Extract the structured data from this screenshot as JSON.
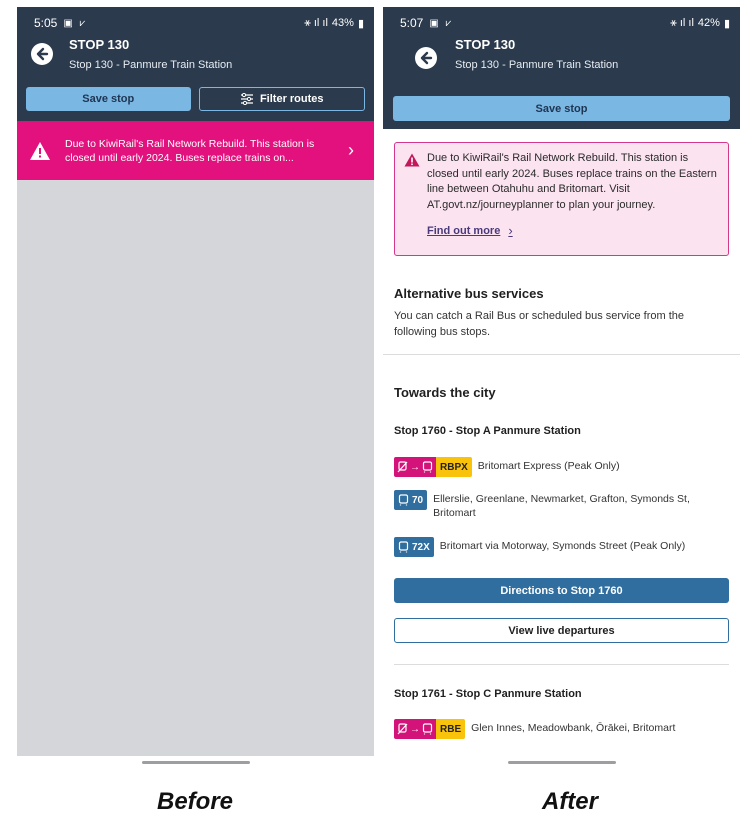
{
  "before": {
    "status": {
      "time": "5:05",
      "icons": "▣ ⩗",
      "right": "43%"
    },
    "stop_title": "STOP 130",
    "stop_subtitle": "Stop 130 - Panmure Train Station",
    "save_label": "Save stop",
    "filter_label": "Filter routes",
    "alert_text": "Due to KiwiRail's Rail Network Rebuild. This station is closed until early 2024. Buses replace trains on..."
  },
  "after": {
    "status": {
      "time": "5:07",
      "icons": "▣ ⩗",
      "right": "42%"
    },
    "stop_title": "STOP 130",
    "stop_subtitle": "Stop 130 - Panmure Train Station",
    "save_label": "Save stop",
    "alert_text": "Due to KiwiRail's Rail Network Rebuild. This station is closed until early 2024. Buses replace trains on the Eastern line between Otahuhu and Britomart. Visit AT.govt.nz/journeyplanner to plan your journey.",
    "find_out_more": "Find out more",
    "alt_title": "Alternative bus services",
    "alt_text": "You can catch a Rail Bus or scheduled bus service from the following bus stops.",
    "towards_title": "Towards the city",
    "stop_a": {
      "heading": "Stop 1760 - Stop A Panmure Station",
      "routes": [
        {
          "code": "RBPX",
          "type": "rail",
          "desc": "Britomart Express (Peak Only)"
        },
        {
          "code": "70",
          "type": "bus",
          "desc": "Ellerslie, Greenlane, Newmarket, Grafton, Symonds St, Britomart"
        },
        {
          "code": "72X",
          "type": "bus",
          "desc": "Britomart via Motorway, Symonds Street (Peak Only)"
        }
      ],
      "directions_label": "Directions to Stop 1760",
      "live_label": "View live departures"
    },
    "stop_c": {
      "heading": "Stop 1761 - Stop C Panmure Station",
      "routes": [
        {
          "code": "RBE",
          "type": "rail",
          "desc": "Glen Innes, Meadowbank, Ōrākei, Britomart"
        }
      ]
    }
  },
  "captions": {
    "before": "Before",
    "after": "After"
  },
  "colors": {
    "header": "#2b3a4c",
    "save_button": "#7bb7e3",
    "alert_pink": "#e2117d",
    "alert_box_bg": "#fbe3f0",
    "rail_badge": "#d3137a",
    "rail_code": "#f9c20b",
    "bus_badge": "#2f6e9f",
    "primary_button": "#2f6e9f"
  },
  "icons": [
    "back-arrow-icon",
    "warning-icon",
    "chevron-right-icon",
    "filter-icon",
    "no-train-icon",
    "arrow-right-icon",
    "bus-icon",
    "signal-icon",
    "battery-icon"
  ]
}
